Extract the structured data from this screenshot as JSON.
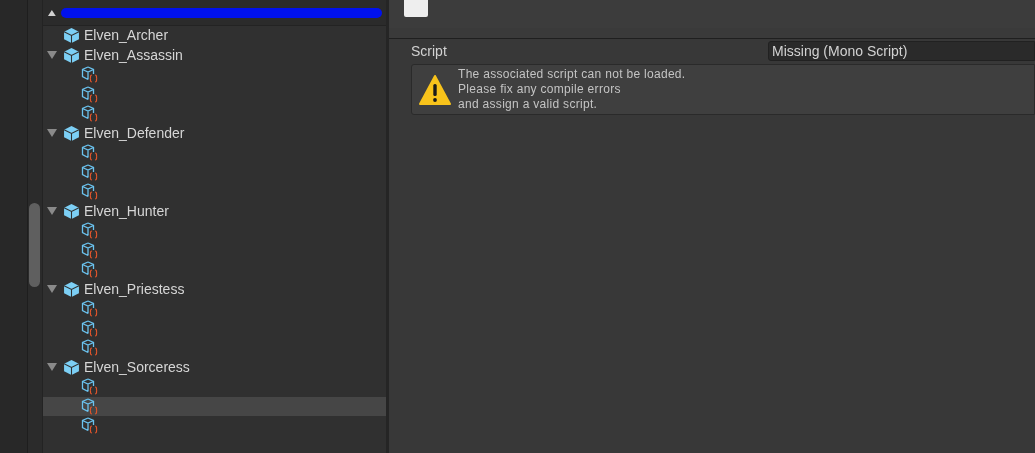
{
  "tree": {
    "items": [
      {
        "label": "Elven_Archer",
        "selected": false
      },
      {
        "label": "Elven_Assassin",
        "expanded": true,
        "selected": false,
        "children": [
          {
            "selected": false
          },
          {
            "selected": false
          },
          {
            "selected": false
          }
        ]
      },
      {
        "label": "Elven_Defender",
        "expanded": true,
        "selected": false,
        "children": [
          {
            "selected": false
          },
          {
            "selected": false
          },
          {
            "selected": false
          }
        ]
      },
      {
        "label": "Elven_Hunter",
        "expanded": true,
        "selected": false,
        "children": [
          {
            "selected": false
          },
          {
            "selected": false
          },
          {
            "selected": false
          }
        ]
      },
      {
        "label": "Elven_Priestess",
        "expanded": true,
        "selected": false,
        "children": [
          {
            "selected": false
          },
          {
            "selected": false
          },
          {
            "selected": false
          }
        ]
      },
      {
        "label": "Elven_Sorceress",
        "expanded": true,
        "selected": false,
        "children": [
          {
            "selected": false
          },
          {
            "selected": true
          },
          {
            "selected": false
          }
        ]
      }
    ]
  },
  "inspector": {
    "field": {
      "label": "Script",
      "value": "Missing (Mono Script)"
    },
    "help_box": {
      "lines": [
        "The associated script can not be loaded.",
        "Please fix any compile errors",
        "and assign a valid script."
      ]
    }
  }
}
